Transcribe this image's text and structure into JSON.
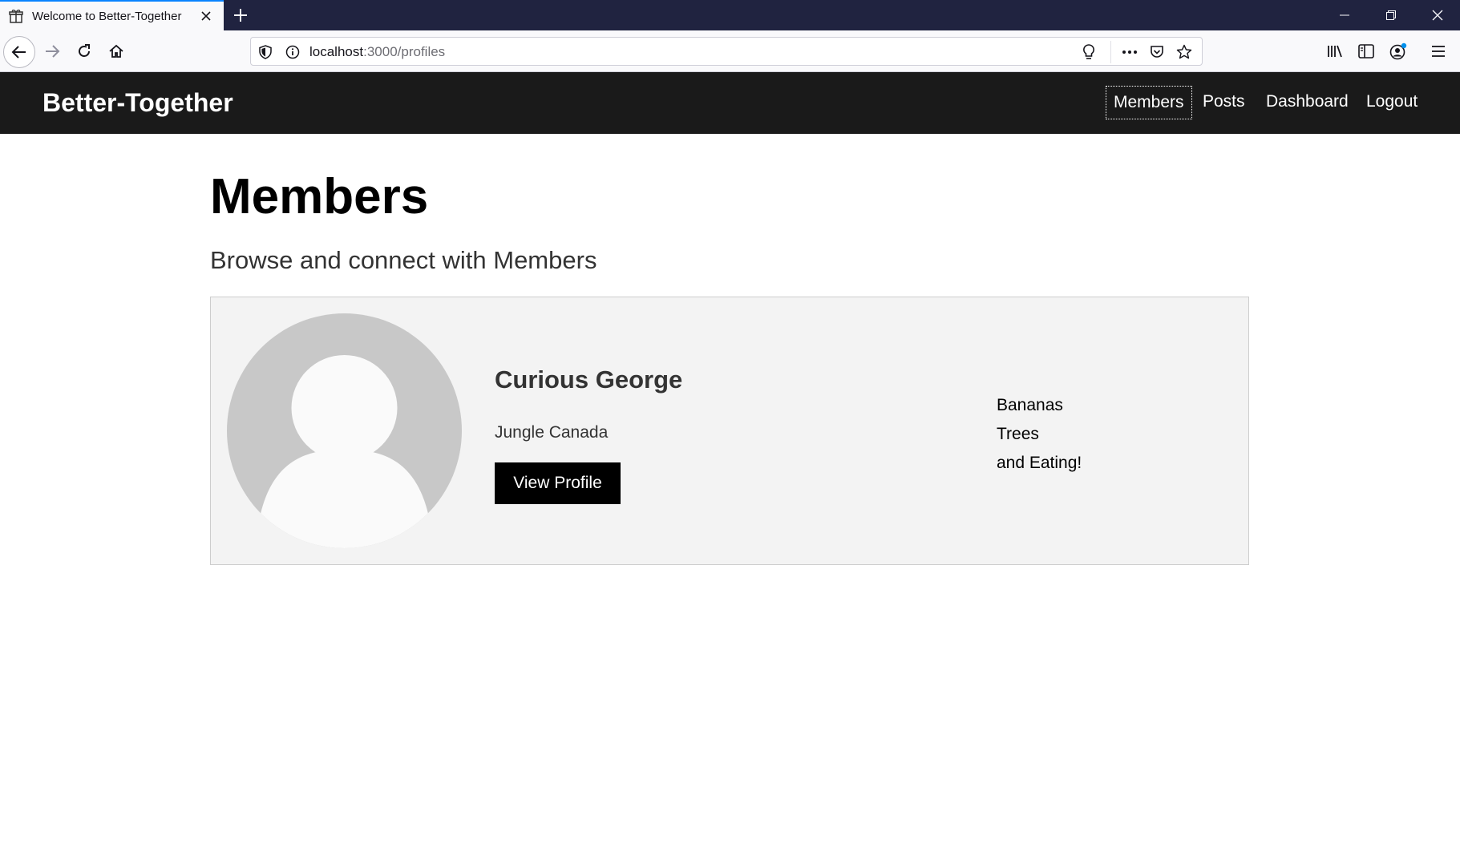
{
  "browser": {
    "tab_title": "Welcome to Better-Together",
    "url_host": "localhost",
    "url_path": ":3000/profiles"
  },
  "header": {
    "brand": "Better-Together",
    "nav": [
      {
        "label": "Members",
        "active": true
      },
      {
        "label": "Posts",
        "active": false
      },
      {
        "label": "Dashboard",
        "active": false
      },
      {
        "label": "Logout",
        "active": false
      }
    ]
  },
  "main": {
    "title": "Members",
    "subtitle": "Browse and connect with Members",
    "members": [
      {
        "name": "Curious George",
        "location": "Jungle Canada",
        "button_label": "View Profile",
        "interests": [
          "Bananas",
          "Trees",
          "and Eating!"
        ]
      }
    ]
  },
  "colors": {
    "header_bg": "#1a1a1a",
    "tabbar_bg": "#202340",
    "card_bg": "#f3f3f3",
    "button_bg": "#000000"
  }
}
